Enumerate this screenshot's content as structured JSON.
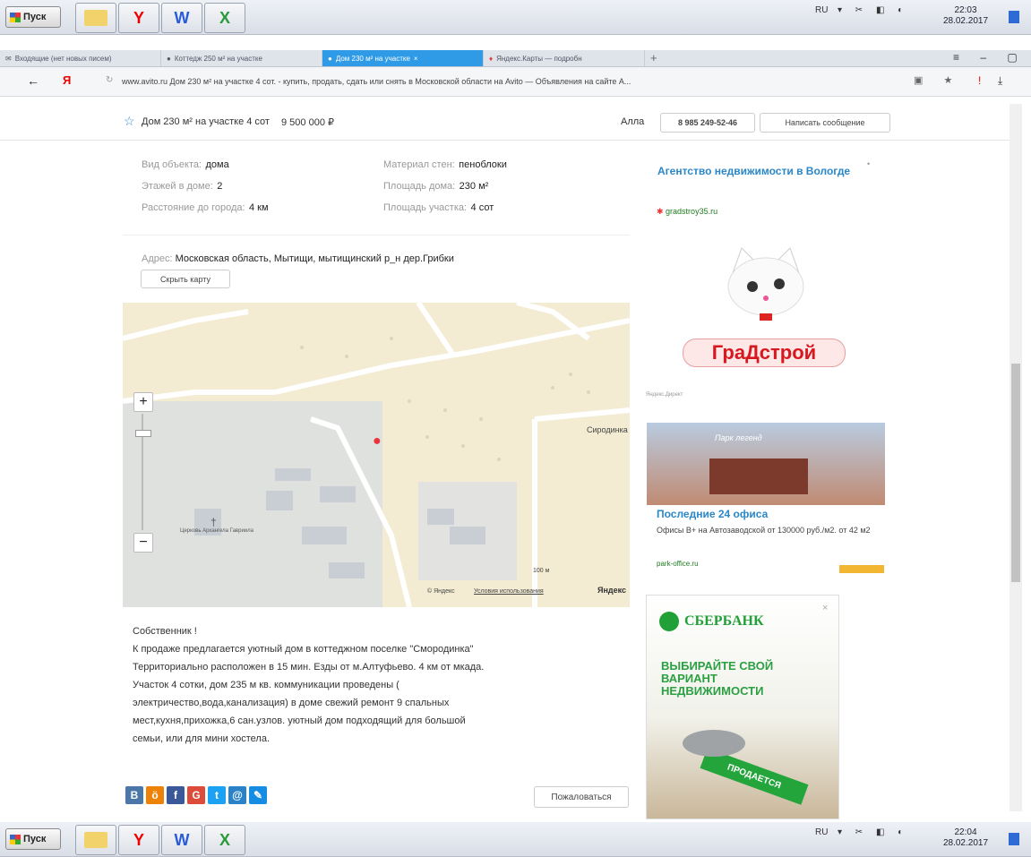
{
  "taskbar": {
    "start_label": "Пуск",
    "lang": "RU",
    "top_time": "22:03",
    "top_date": "28.02.2017",
    "bottom_time": "22:04",
    "bottom_date": "28.02.2017"
  },
  "tabs": [
    {
      "label": "Входящие (нет новых писем)"
    },
    {
      "label": "Коттедж 250 м² на участке"
    },
    {
      "label": "Дом 230 м² на участке"
    },
    {
      "label": "Яндекс.Карты — подробн"
    }
  ],
  "address": "www.avito.ru  Дом 230 м² на участке 4 сот. - купить, продать, сдать или снять в Московской области на Avito — Объявления на сайте А...",
  "header": {
    "title": "Дом 230 м² на участке 4 сот",
    "price": "9 500 000 ₽",
    "seller": "Алла",
    "phone": "8 985 249-52-46",
    "message_label": "Написать сообщение"
  },
  "params": [
    {
      "label": "Вид объекта:",
      "value": "дома"
    },
    {
      "label": "Этажей в доме:",
      "value": "2"
    },
    {
      "label": "Расстояние до города:",
      "value": "4 км"
    },
    {
      "label": "Материал стен:",
      "value": "пеноблоки"
    },
    {
      "label": "Площадь дома:",
      "value": "230 м²"
    },
    {
      "label": "Площадь участка:",
      "value": "4 сот"
    }
  ],
  "address_row": {
    "label": "Адрес:",
    "value": "Московская область, Мытищи, мытищинский р_н дер.Грибки",
    "hide_map_label": "Скрыть карту"
  },
  "map": {
    "zoom_in": "+",
    "zoom_out": "−",
    "place_label": "Сиродинка",
    "church_label": "Церковь Архангела Гавриила",
    "scale": "100 м",
    "attribution": "© Яндекс",
    "terms": "Условия использования",
    "logo": "Яндекс"
  },
  "description": [
    "Собственник !",
    "К продаже предлагается уютный дом в коттеджном поселке \"Смородинка\"",
    "Территориально расположен в 15 мин. Езды от м.Алтуфьево. 4 км от мкада.",
    "Участок 4 сотки, дом 235 м кв. коммуникации проведены (",
    "электричество,вода,канализация) в доме свежий ремонт 9 спальных",
    "мест,кухня,прихожка,6 сан.узлов. уютный дом подходящий для большой",
    "семьи, или для мини хостела."
  ],
  "complain_label": "Пожаловаться",
  "ads": {
    "agency_title": "Агентство недвижимости в Вологде",
    "agency_domain": "gradstroy35.ru",
    "brand": "ГраДстрой",
    "direct": "Яндекс.Директ",
    "office_title": "Последние 24 офиса",
    "office_text": "Офисы В+ на Автозаводской от 130000 руб./м2. от 42 м2",
    "office_domain": "park-office.ru",
    "office_banner": "Парк легенд",
    "bank_name": "СБЕРБАНК",
    "bank_slogan": "ВЫБИРАЙТЕ СВОЙ ВАРИАНТ НЕДВИЖИМОСТИ",
    "bank_key_tag": "ПРОДАЕТСЯ"
  }
}
